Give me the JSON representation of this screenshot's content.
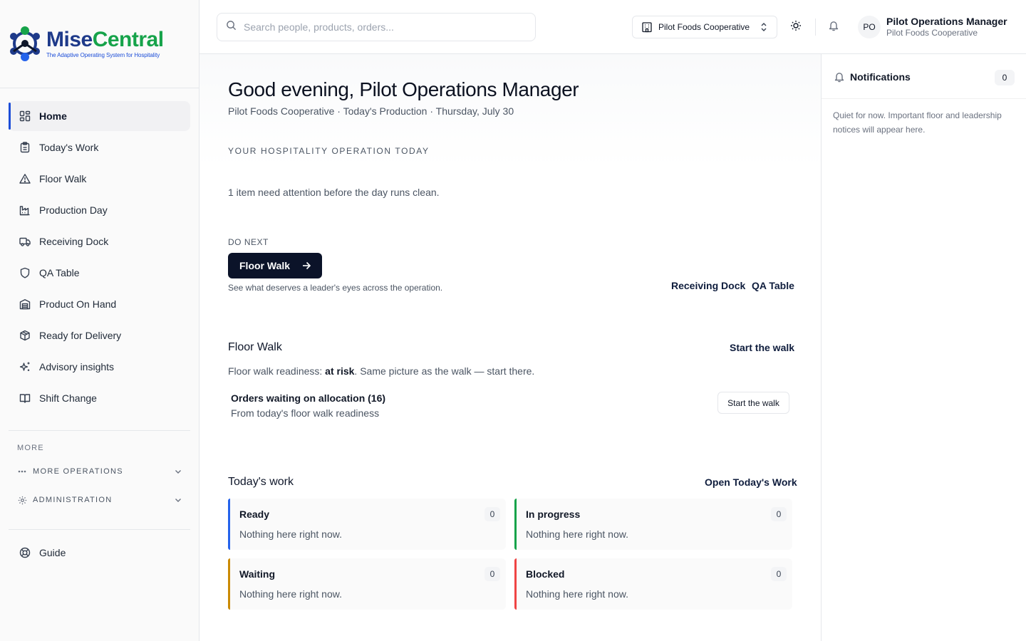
{
  "app": {
    "logo_name_part1": "Mise",
    "logo_name_part2": "Central",
    "logo_tagline": "The Adaptive Operating System for Hospitality",
    "brand_colors": {
      "navy": "#1e3a8a",
      "green": "#16a34a"
    }
  },
  "sidebar": {
    "items": [
      {
        "label": "Home",
        "icon": "grid-icon",
        "active": true
      },
      {
        "label": "Today's Work",
        "icon": "clipboard-icon",
        "active": false
      },
      {
        "label": "Floor Walk",
        "icon": "alert-triangle-icon",
        "active": false
      },
      {
        "label": "Production Day",
        "icon": "factory-icon",
        "active": false
      },
      {
        "label": "Receiving Dock",
        "icon": "truck-icon",
        "active": false
      },
      {
        "label": "QA Table",
        "icon": "shield-icon",
        "active": false
      },
      {
        "label": "Product On Hand",
        "icon": "warehouse-icon",
        "active": false
      },
      {
        "label": "Ready for Delivery",
        "icon": "package-icon",
        "active": false
      },
      {
        "label": "Advisory insights",
        "icon": "sparkles-icon",
        "active": false
      },
      {
        "label": "Shift Change",
        "icon": "book-open-icon",
        "active": false
      }
    ],
    "more_label": "MORE",
    "more_operations_label": "MORE OPERATIONS",
    "administration_label": "ADMINISTRATION",
    "guide_label": "Guide"
  },
  "topbar": {
    "search_placeholder": "Search people, products, orders...",
    "org_select_value": "Pilot Foods Cooperative",
    "user_initials": "PO",
    "user_name": "Pilot Operations Manager",
    "user_org": "Pilot Foods Cooperative"
  },
  "main": {
    "greeting": "Good evening, Pilot Operations Manager",
    "subline": "Pilot Foods Cooperative · Today's Production · Thursday, July 30",
    "section_caps": "YOUR HOSPITALITY OPERATION TODAY",
    "attention_text": "1 item need attention before the day runs clean.",
    "do_next_label": "DO NEXT",
    "do_next_button": "Floor Walk",
    "do_next_desc": "See what deserves a leader's eyes across the operation.",
    "quick_links": [
      "Receiving Dock",
      "QA Table"
    ],
    "floor_walk": {
      "title": "Floor Walk",
      "action_link": "Start the walk",
      "readiness_prefix": "Floor walk readiness: ",
      "readiness_status": "at risk",
      "readiness_suffix": ". Same picture as the walk — start there.",
      "order_title": "Orders waiting on allocation (16)",
      "order_sub": "From today's floor walk readiness",
      "order_button": "Start the walk"
    },
    "todays_work": {
      "title": "Today's work",
      "action_link": "Open Today's Work",
      "cards": [
        {
          "title": "Ready",
          "count": "0",
          "body": "Nothing here right now.",
          "accent": "#2563eb"
        },
        {
          "title": "In progress",
          "count": "0",
          "body": "Nothing here right now.",
          "accent": "#16a34a"
        },
        {
          "title": "Waiting",
          "count": "0",
          "body": "Nothing here right now.",
          "accent": "#ca8a04"
        },
        {
          "title": "Blocked",
          "count": "0",
          "body": "Nothing here right now.",
          "accent": "#ef4444"
        }
      ]
    }
  },
  "notifications": {
    "title": "Notifications",
    "count": "0",
    "empty_text": "Quiet for now. Important floor and leadership notices will appear here."
  }
}
